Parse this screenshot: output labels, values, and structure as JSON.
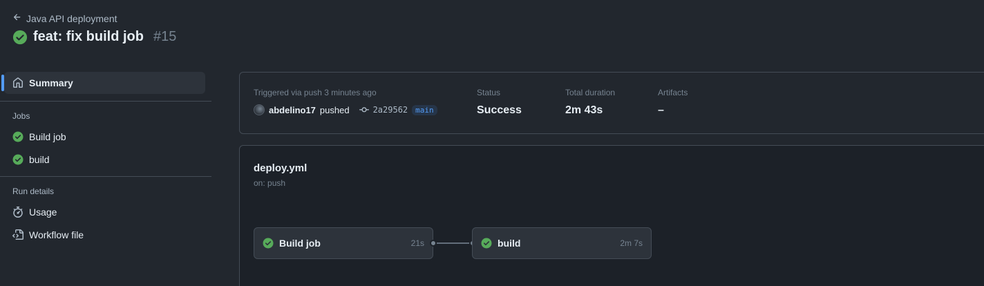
{
  "header": {
    "back_label": "Java API deployment",
    "title": "feat: fix build job",
    "run_number": "#15"
  },
  "sidebar": {
    "summary_label": "Summary",
    "jobs_heading": "Jobs",
    "jobs": [
      {
        "label": "Build job",
        "status": "success"
      },
      {
        "label": "build",
        "status": "success"
      }
    ],
    "run_details_heading": "Run details",
    "details": [
      {
        "label": "Usage",
        "icon": "stopwatch-icon"
      },
      {
        "label": "Workflow file",
        "icon": "file-code-icon"
      }
    ]
  },
  "summary": {
    "trigger_label": "Triggered via push 3 minutes ago",
    "actor": "abdelino17",
    "action": "pushed",
    "commit_sha": "2a29562",
    "branch": "main",
    "status_label": "Status",
    "status_value": "Success",
    "duration_label": "Total duration",
    "duration_value": "2m 43s",
    "artifacts_label": "Artifacts",
    "artifacts_value": "–"
  },
  "workflow": {
    "file": "deploy.yml",
    "trigger": "on: push",
    "jobs": [
      {
        "name": "Build job",
        "duration": "21s",
        "status": "success"
      },
      {
        "name": "build",
        "duration": "2m 7s",
        "status": "success"
      }
    ]
  },
  "colors": {
    "success": "#57ab5a",
    "accent": "#539bf5",
    "background": "#22272e"
  }
}
